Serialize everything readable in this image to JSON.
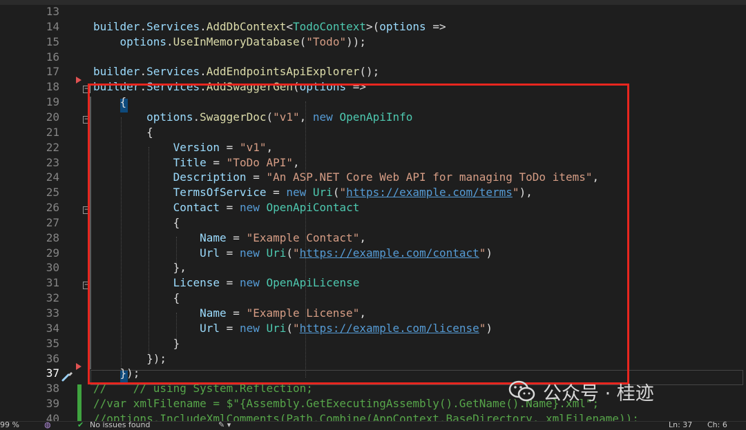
{
  "editor": {
    "lines": [
      {
        "n": "13",
        "tokens": []
      },
      {
        "n": "14",
        "tokens": [
          [
            "i",
            "builder"
          ],
          [
            "p",
            "."
          ],
          [
            "i",
            "Services"
          ],
          [
            "p",
            "."
          ],
          [
            "m",
            "AddDbContext"
          ],
          [
            "p",
            "<"
          ],
          [
            "t",
            "TodoContext"
          ],
          [
            "p",
            ">("
          ],
          [
            "i",
            "options"
          ],
          [
            "p",
            " =>"
          ]
        ]
      },
      {
        "n": "15",
        "tokens": [
          [
            "p",
            "    "
          ],
          [
            "i",
            "options"
          ],
          [
            "p",
            "."
          ],
          [
            "m",
            "UseInMemoryDatabase"
          ],
          [
            "p",
            "("
          ],
          [
            "s",
            "\"Todo\""
          ],
          [
            "p",
            "));"
          ]
        ]
      },
      {
        "n": "16",
        "tokens": []
      },
      {
        "n": "17",
        "tokens": [
          [
            "i",
            "builder"
          ],
          [
            "p",
            "."
          ],
          [
            "i",
            "Services"
          ],
          [
            "p",
            "."
          ],
          [
            "m",
            "AddEndpointsApiExplorer"
          ],
          [
            "p",
            "();"
          ]
        ]
      },
      {
        "n": "18",
        "tokens": [
          [
            "i",
            "builder"
          ],
          [
            "p",
            "."
          ],
          [
            "i",
            "Services"
          ],
          [
            "p",
            "."
          ],
          [
            "m",
            "AddSwaggerGen"
          ],
          [
            "p",
            "("
          ],
          [
            "i",
            "options"
          ],
          [
            "p",
            " =>"
          ]
        ]
      },
      {
        "n": "19",
        "tokens": [
          [
            "p",
            "    {"
          ]
        ]
      },
      {
        "n": "20",
        "tokens": [
          [
            "p",
            "        "
          ],
          [
            "i",
            "options"
          ],
          [
            "p",
            "."
          ],
          [
            "m",
            "SwaggerDoc"
          ],
          [
            "p",
            "("
          ],
          [
            "s",
            "\"v1\""
          ],
          [
            "p",
            ", "
          ],
          [
            "k",
            "new"
          ],
          [
            "p",
            " "
          ],
          [
            "t",
            "OpenApiInfo"
          ]
        ]
      },
      {
        "n": "21",
        "tokens": [
          [
            "p",
            "        {"
          ]
        ]
      },
      {
        "n": "22",
        "tokens": [
          [
            "p",
            "            "
          ],
          [
            "i",
            "Version"
          ],
          [
            "p",
            " = "
          ],
          [
            "s",
            "\"v1\""
          ],
          [
            "p",
            ","
          ]
        ]
      },
      {
        "n": "23",
        "tokens": [
          [
            "p",
            "            "
          ],
          [
            "i",
            "Title"
          ],
          [
            "p",
            " = "
          ],
          [
            "s",
            "\"ToDo API\""
          ],
          [
            "p",
            ","
          ]
        ]
      },
      {
        "n": "24",
        "tokens": [
          [
            "p",
            "            "
          ],
          [
            "i",
            "Description"
          ],
          [
            "p",
            " = "
          ],
          [
            "s",
            "\"An ASP.NET Core Web API for managing ToDo items\""
          ],
          [
            "p",
            ","
          ]
        ]
      },
      {
        "n": "25",
        "tokens": [
          [
            "p",
            "            "
          ],
          [
            "i",
            "TermsOfService"
          ],
          [
            "p",
            " = "
          ],
          [
            "k",
            "new"
          ],
          [
            "p",
            " "
          ],
          [
            "t",
            "Uri"
          ],
          [
            "p",
            "("
          ],
          [
            "s",
            "\""
          ],
          [
            "u",
            "https://example.com/terms"
          ],
          [
            "s",
            "\""
          ],
          [
            "p",
            "),"
          ]
        ]
      },
      {
        "n": "26",
        "tokens": [
          [
            "p",
            "            "
          ],
          [
            "i",
            "Contact"
          ],
          [
            "p",
            " = "
          ],
          [
            "k",
            "new"
          ],
          [
            "p",
            " "
          ],
          [
            "t",
            "OpenApiContact"
          ]
        ]
      },
      {
        "n": "27",
        "tokens": [
          [
            "p",
            "            {"
          ]
        ]
      },
      {
        "n": "28",
        "tokens": [
          [
            "p",
            "                "
          ],
          [
            "i",
            "Name"
          ],
          [
            "p",
            " = "
          ],
          [
            "s",
            "\"Example Contact\""
          ],
          [
            "p",
            ","
          ]
        ]
      },
      {
        "n": "29",
        "tokens": [
          [
            "p",
            "                "
          ],
          [
            "i",
            "Url"
          ],
          [
            "p",
            " = "
          ],
          [
            "k",
            "new"
          ],
          [
            "p",
            " "
          ],
          [
            "t",
            "Uri"
          ],
          [
            "p",
            "("
          ],
          [
            "s",
            "\""
          ],
          [
            "u",
            "https://example.com/contact"
          ],
          [
            "s",
            "\""
          ],
          [
            "p",
            ")"
          ]
        ]
      },
      {
        "n": "30",
        "tokens": [
          [
            "p",
            "            },"
          ]
        ]
      },
      {
        "n": "31",
        "tokens": [
          [
            "p",
            "            "
          ],
          [
            "i",
            "License"
          ],
          [
            "p",
            " = "
          ],
          [
            "k",
            "new"
          ],
          [
            "p",
            " "
          ],
          [
            "t",
            "OpenApiLicense"
          ]
        ]
      },
      {
        "n": "32",
        "tokens": [
          [
            "p",
            "            {"
          ]
        ]
      },
      {
        "n": "33",
        "tokens": [
          [
            "p",
            "                "
          ],
          [
            "i",
            "Name"
          ],
          [
            "p",
            " = "
          ],
          [
            "s",
            "\"Example License\""
          ],
          [
            "p",
            ","
          ]
        ]
      },
      {
        "n": "34",
        "tokens": [
          [
            "p",
            "                "
          ],
          [
            "i",
            "Url"
          ],
          [
            "p",
            " = "
          ],
          [
            "k",
            "new"
          ],
          [
            "p",
            " "
          ],
          [
            "t",
            "Uri"
          ],
          [
            "p",
            "("
          ],
          [
            "s",
            "\""
          ],
          [
            "u",
            "https://example.com/license"
          ],
          [
            "s",
            "\""
          ],
          [
            "p",
            ")"
          ]
        ]
      },
      {
        "n": "35",
        "tokens": [
          [
            "p",
            "            }"
          ]
        ]
      },
      {
        "n": "36",
        "tokens": [
          [
            "p",
            "        });"
          ]
        ]
      },
      {
        "n": "37",
        "tokens": [
          [
            "p",
            "    });"
          ]
        ]
      },
      {
        "n": "38",
        "comment": "//    // using System.Reflection;"
      },
      {
        "n": "39",
        "comment": "//var xmlFilename = $\"{Assembly.GetExecutingAssembly().GetName().Name}.xml\";"
      },
      {
        "n": "40",
        "comment": "//options.IncludeXmlComments(Path.Combine(AppContext.BaseDirectory, xmlFilename));"
      }
    ]
  },
  "status": {
    "zoom": "99 %",
    "issues": "No issues found",
    "line": "Ln: 37",
    "col": "Ch: 6"
  },
  "watermark": {
    "text": "公众号 · 桂迹"
  },
  "colors": {
    "highlight_box": "#e8261f",
    "keyword": "#569cd6",
    "type": "#4ec9b0",
    "identifier": "#9cdcfe",
    "method": "#dcdcaa",
    "string": "#d69d85",
    "comment": "#57a64a"
  }
}
